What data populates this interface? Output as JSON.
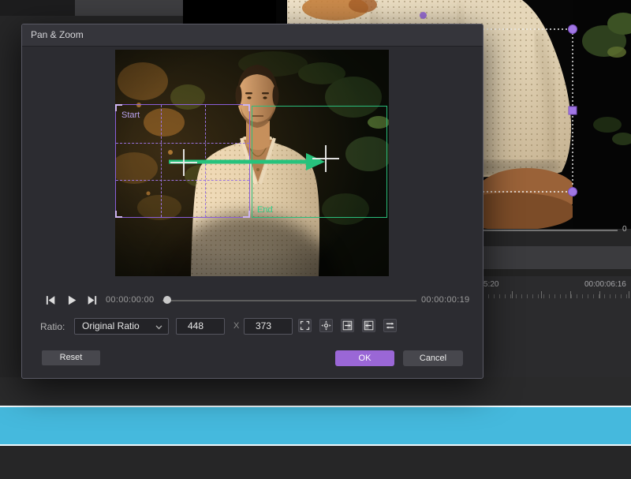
{
  "dialog": {
    "title": "Pan & Zoom",
    "overlay": {
      "start_label": "Start",
      "end_label": "End"
    },
    "transport": {
      "current_time": "00:00:00:00",
      "total_time": "00:00:00:19"
    },
    "ratio": {
      "label": "Ratio:",
      "selected_option": "Original Ratio",
      "width": "448",
      "separator": "X",
      "height": "373"
    },
    "tools": {
      "fit": "fit-to-screen",
      "move": "free-move",
      "pan_right": "pan-right",
      "pan_left": "pan-left",
      "swap": "swap-start-end"
    },
    "actions": {
      "reset": "Reset",
      "ok": "OK",
      "cancel": "Cancel"
    }
  },
  "background": {
    "ruler": {
      "left_label": "5:20",
      "right_label": "00:00:06:16"
    },
    "preview_time_fragment": "0",
    "colors": {
      "clip_bar": "#45b9dd",
      "accent_purple": "#9a6fd4",
      "start_box": "#8a5fd8",
      "end_box": "#2abd7b",
      "arrow": "#27c27c",
      "ok_button": "#9a67d6"
    }
  }
}
